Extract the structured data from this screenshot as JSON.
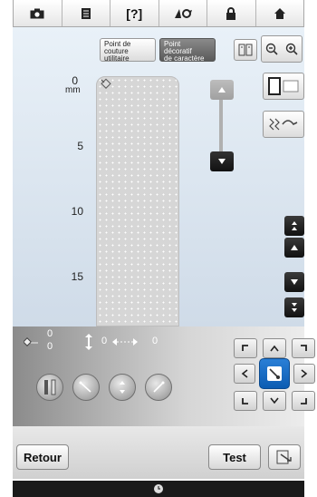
{
  "toolbar": {
    "items": [
      {
        "name": "camera",
        "icon": "camera-icon"
      },
      {
        "name": "document",
        "icon": "document-icon"
      },
      {
        "name": "help",
        "icon": "help-icon",
        "label": "[?]"
      },
      {
        "name": "threading",
        "icon": "threading-icon"
      },
      {
        "name": "lock",
        "icon": "lock-icon"
      },
      {
        "name": "home",
        "icon": "home-icon"
      }
    ]
  },
  "modes": {
    "utility_label_1": "Point de",
    "utility_label_2": "couture",
    "utility_label_3": "utilitaire",
    "decorative_label_1": "Point",
    "decorative_label_2": "décoratif",
    "decorative_label_3": "de caractère"
  },
  "ruler": {
    "unit": "mm",
    "ticks": [
      "0",
      "5",
      "10",
      "15"
    ]
  },
  "readouts": {
    "width_top": "0",
    "width_bottom": "0",
    "length": "0",
    "spacing": "0"
  },
  "buttons": {
    "back": "Retour",
    "test": "Test"
  },
  "colors": {
    "accent": "#0c5cb2",
    "panel_dark": "#1a1a1a"
  }
}
